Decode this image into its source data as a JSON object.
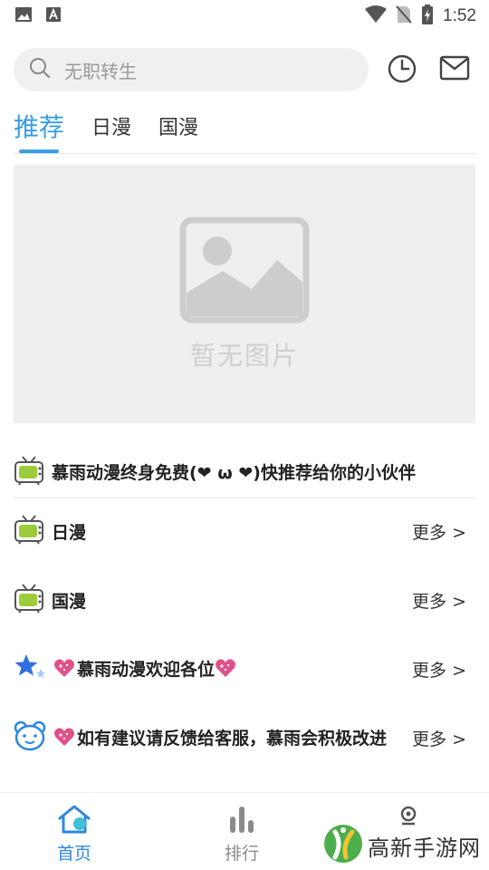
{
  "status_bar": {
    "time": "1:52"
  },
  "search": {
    "placeholder": "无职转生"
  },
  "tabs": [
    {
      "label": "推荐",
      "active": true
    },
    {
      "label": "日漫",
      "active": false
    },
    {
      "label": "国漫",
      "active": false
    }
  ],
  "banner": {
    "empty_text": "暂无图片"
  },
  "announcement": {
    "text": "慕雨动漫终身免费(❤ ω ❤)快推荐给你的小伙伴"
  },
  "sections": [
    {
      "title": "日漫",
      "more": "更多 >",
      "icon": "tv-icon"
    },
    {
      "title": "国漫",
      "more": "更多 >",
      "icon": "tv-icon"
    },
    {
      "title": "慕雨动漫欢迎各位",
      "more": "更多 >",
      "icon": "star-icon"
    },
    {
      "title": "如有建议请反馈给客服，慕雨会积极改进",
      "more": "更多 >",
      "icon": "bear-icon"
    }
  ],
  "bottom_nav": [
    {
      "label": "首页",
      "icon": "home-icon",
      "active": true
    },
    {
      "label": "排行",
      "icon": "ranking-icon",
      "active": false
    },
    {
      "label": "",
      "icon": "profile-icon",
      "active": false
    }
  ],
  "watermark": {
    "text": "高新手游网"
  },
  "colors": {
    "accent": "#3a9ee4",
    "nav_active": "#2f86e0",
    "heart": "#e0508a"
  }
}
